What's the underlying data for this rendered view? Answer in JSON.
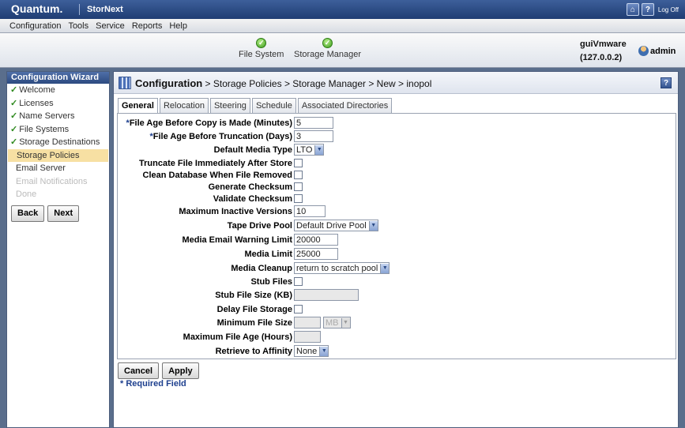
{
  "app": {
    "brand": "Quantum.",
    "product": "StorNext",
    "logoff": "Log Off",
    "help_glyph": "?"
  },
  "menu": [
    "Configuration",
    "Tools",
    "Service",
    "Reports",
    "Help"
  ],
  "status": [
    {
      "label": "File System",
      "state": "ok"
    },
    {
      "label": "Storage Manager",
      "state": "ok"
    }
  ],
  "host": {
    "name": "guiVmware",
    "ip": "(127.0.0.2)",
    "user": "admin"
  },
  "wizard": {
    "title": "Configuration Wizard",
    "check_glyph": "✓",
    "steps": [
      {
        "label": "Welcome",
        "state": "done"
      },
      {
        "label": "Licenses",
        "state": "done"
      },
      {
        "label": "Name Servers",
        "state": "done"
      },
      {
        "label": "File Systems",
        "state": "done"
      },
      {
        "label": "Storage Destinations",
        "state": "done"
      },
      {
        "label": "Storage Policies",
        "state": "active"
      },
      {
        "label": "Email Server",
        "state": "plain"
      },
      {
        "label": "Email Notifications",
        "state": "disabled"
      },
      {
        "label": "Done",
        "state": "disabled"
      }
    ],
    "back": "Back",
    "next": "Next"
  },
  "breadcrumb": {
    "head": "Configuration",
    "rest": " > Storage Policies > Storage Manager > New > inopol"
  },
  "tabs": [
    "General",
    "Relocation",
    "Steering",
    "Schedule",
    "Associated Directories"
  ],
  "form": {
    "copy_age": {
      "label": "File Age Before Copy is Made (Minutes)",
      "value": "5"
    },
    "trunc_age": {
      "label": "File Age Before Truncation (Days)",
      "value": "3"
    },
    "media_type": {
      "label": "Default Media Type",
      "value": "LTO"
    },
    "trunc_immediate": {
      "label": "Truncate File Immediately After Store"
    },
    "clean_db": {
      "label": "Clean Database When File Removed"
    },
    "gen_checksum": {
      "label": "Generate Checksum"
    },
    "val_checksum": {
      "label": "Validate Checksum"
    },
    "max_versions": {
      "label": "Maximum Inactive Versions",
      "value": "10"
    },
    "tape_pool": {
      "label": "Tape Drive Pool",
      "value": "Default Drive Pool"
    },
    "email_warn": {
      "label": "Media Email Warning Limit",
      "value": "20000"
    },
    "media_limit": {
      "label": "Media Limit",
      "value": "25000"
    },
    "media_cleanup": {
      "label": "Media Cleanup",
      "value": "return to scratch pool"
    },
    "stub_files": {
      "label": "Stub Files"
    },
    "stub_size": {
      "label": "Stub File Size (KB)",
      "value": ""
    },
    "delay_storage": {
      "label": "Delay File Storage"
    },
    "min_size": {
      "label": "Minimum File Size",
      "value": "",
      "unit": "MB"
    },
    "max_age": {
      "label": "Maximum File Age (Hours)",
      "value": ""
    },
    "affinity": {
      "label": "Retrieve to Affinity",
      "value": "None"
    },
    "required_marker": "*"
  },
  "actions": {
    "cancel": "Cancel",
    "apply": "Apply"
  },
  "required_note": "* Required Field"
}
